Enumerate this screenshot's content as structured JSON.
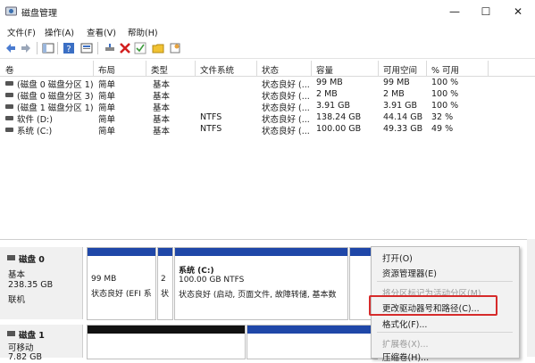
{
  "window": {
    "title": "磁盘管理",
    "minimize": "—",
    "maximize": "☐",
    "close": "✕"
  },
  "menu": [
    "文件(F)",
    "操作(A)",
    "查看(V)",
    "帮助(H)"
  ],
  "table": {
    "headers": [
      "卷",
      "布局",
      "类型",
      "文件系统",
      "状态",
      "容量",
      "可用空间",
      "% 可用"
    ],
    "rows": [
      [
        "(磁盘 0 磁盘分区 1)",
        "简单",
        "基本",
        "",
        "状态良好 (...",
        "99 MB",
        "99 MB",
        "100 %"
      ],
      [
        "(磁盘 0 磁盘分区 3)",
        "简单",
        "基本",
        "",
        "状态良好 (...",
        "2 MB",
        "2 MB",
        "100 %"
      ],
      [
        "(磁盘 1 磁盘分区 1)",
        "简单",
        "基本",
        "",
        "状态良好 (...",
        "3.91 GB",
        "3.91 GB",
        "100 %"
      ],
      [
        "软件 (D:)",
        "简单",
        "基本",
        "NTFS",
        "状态良好 (...",
        "138.24 GB",
        "44.14 GB",
        "32 %"
      ],
      [
        "系统 (C:)",
        "简单",
        "基本",
        "NTFS",
        "状态良好 (...",
        "100.00 GB",
        "49.33 GB",
        "49 %"
      ]
    ]
  },
  "disks": [
    {
      "name": "磁盘 0",
      "type": "基本",
      "size": "238.35 GB",
      "status": "联机",
      "partitions": [
        {
          "line1": "99 MB",
          "line2": "状态良好 (EFI 系"
        },
        {
          "line1": "2",
          "line2": "状"
        },
        {
          "title": "系统 (C:)",
          "line1": "100.00 GB NTFS",
          "line2": "状态良好 (启动, 页面文件, 故障转储, 基本数"
        },
        {
          "line1": "",
          "line2": ""
        }
      ]
    },
    {
      "name": "磁盘 1",
      "type": "可移动",
      "size": "7.82 GB",
      "partitions": [
        {
          "line1": "",
          "line2": ""
        }
      ]
    }
  ],
  "context_menu": {
    "items": [
      {
        "label": "打开(O)",
        "enabled": true
      },
      {
        "label": "资源管理器(E)",
        "enabled": true
      },
      {
        "label": "将分区标记为活动分区(M)",
        "enabled": false
      },
      {
        "label": "更改驱动器号和路径(C)...",
        "enabled": true,
        "highlighted": true
      },
      {
        "label": "格式化(F)...",
        "enabled": true
      },
      {
        "label": "扩展卷(X)...",
        "enabled": false
      },
      {
        "label": "压缩卷(H)...",
        "enabled": true
      }
    ]
  },
  "colors": {
    "partition_header": "#1f47a8",
    "unallocated_header": "#111111",
    "highlight_border": "#d62b2b"
  }
}
